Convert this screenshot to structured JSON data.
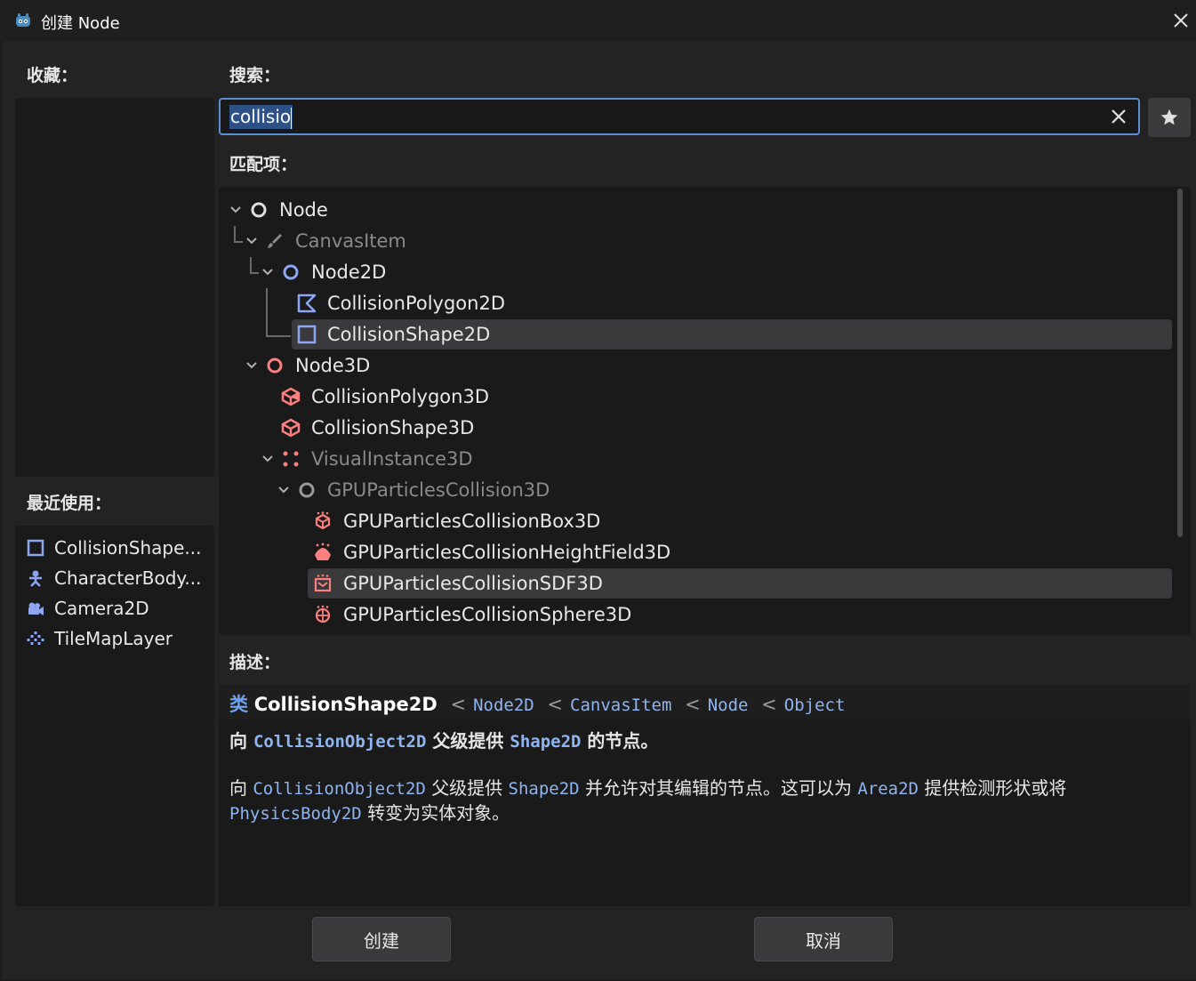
{
  "window": {
    "title": "创建 Node"
  },
  "favorites": {
    "label": "收藏："
  },
  "recent": {
    "label": "最近使用：",
    "items": [
      {
        "label": "CollisionShape...",
        "icon": "collision-shape-2d-icon"
      },
      {
        "label": "CharacterBody...",
        "icon": "character-body-icon"
      },
      {
        "label": "Camera2D",
        "icon": "camera-2d-icon"
      },
      {
        "label": "TileMapLayer",
        "icon": "tilemap-layer-icon"
      }
    ]
  },
  "search": {
    "label": "搜索：",
    "value": "collisio"
  },
  "matches": {
    "label": "匹配项：",
    "items": [
      {
        "label": "Node",
        "icon": "node-icon",
        "dim": false
      },
      {
        "label": "CanvasItem",
        "icon": "canvas-item-icon",
        "dim": true
      },
      {
        "label": "Node2D",
        "icon": "node-2d-icon",
        "dim": false
      },
      {
        "label": "CollisionPolygon2D",
        "icon": "collision-polygon-2d-icon",
        "dim": false
      },
      {
        "label": "CollisionShape2D",
        "icon": "collision-shape-2d-icon",
        "dim": false,
        "selected": true
      },
      {
        "label": "Node3D",
        "icon": "node-3d-icon",
        "dim": false
      },
      {
        "label": "CollisionPolygon3D",
        "icon": "collision-polygon-3d-icon",
        "dim": false
      },
      {
        "label": "CollisionShape3D",
        "icon": "collision-shape-3d-icon",
        "dim": false
      },
      {
        "label": "VisualInstance3D",
        "icon": "visual-instance-3d-icon",
        "dim": true
      },
      {
        "label": "GPUParticlesCollision3D",
        "icon": "gpu-particles-collision-3d-icon",
        "dim": true
      },
      {
        "label": "GPUParticlesCollisionBox3D",
        "icon": "gpu-collision-box-icon",
        "dim": false
      },
      {
        "label": "GPUParticlesCollisionHeightField3D",
        "icon": "gpu-collision-heightfield-icon",
        "dim": false
      },
      {
        "label": "GPUParticlesCollisionSDF3D",
        "icon": "gpu-collision-sdf-icon",
        "dim": false,
        "hover": true
      },
      {
        "label": "GPUParticlesCollisionSphere3D",
        "icon": "gpu-collision-sphere-icon",
        "dim": false
      }
    ]
  },
  "description": {
    "label": "描述：",
    "kind": "类",
    "class_name": "CollisionShape2D",
    "inherits": [
      "Node2D",
      "CanvasItem",
      "Node",
      "Object"
    ],
    "separator": "<",
    "brief": {
      "prefix": "向",
      "ref1": "CollisionObject2D",
      "mid": "父级提供",
      "ref2": "Shape2D",
      "suffix": "的节点。"
    },
    "long": {
      "p1": "向",
      "ref1": "CollisionObject2D",
      "p2": "父级提供",
      "ref2": "Shape2D",
      "p3": "并允许对其编辑的节点。这可以为",
      "ref3": "Area2D",
      "p4": "提供检测形状或将",
      "ref4": "PhysicsBody2D",
      "p5": "转变为实体对象。"
    }
  },
  "buttons": {
    "create": "创建",
    "cancel": "取消"
  },
  "colors": {
    "accent": "#5a8fd6",
    "node2d": "#8da5f3",
    "node3d": "#fc7f7f",
    "selection": "#3a3a3c"
  }
}
